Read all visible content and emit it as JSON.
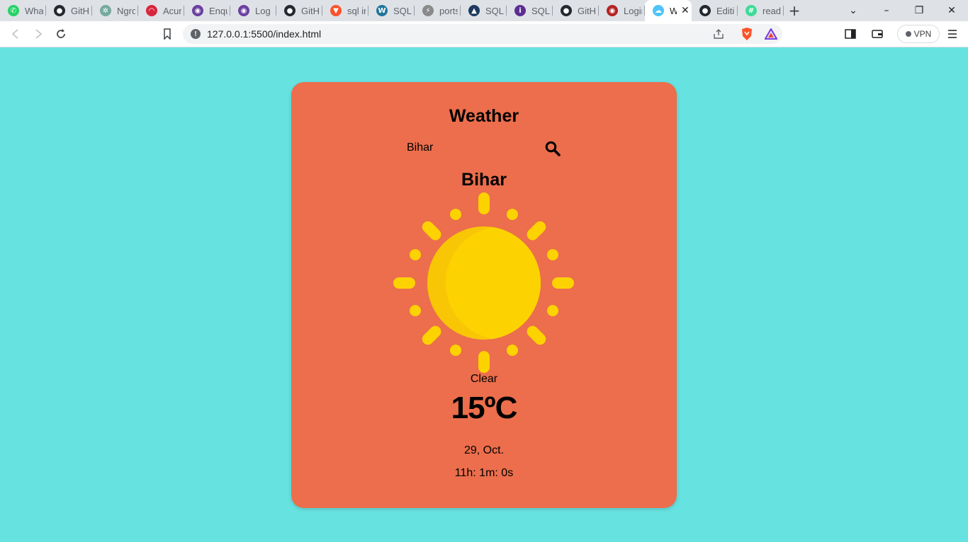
{
  "browser": {
    "tabs": [
      {
        "title": "What",
        "icon": "whatsapp-icon",
        "color": "#25d366"
      },
      {
        "title": "GitHu",
        "icon": "github-icon",
        "color": "#24292f"
      },
      {
        "title": "Ngro",
        "icon": "chatgpt-icon",
        "color": "#74aa9c"
      },
      {
        "title": "Acun",
        "icon": "acunetix-icon",
        "color": "#d7263d"
      },
      {
        "title": "Enqu",
        "icon": "site-icon",
        "color": "#6b3fa0"
      },
      {
        "title": "Log I",
        "icon": "site-icon",
        "color": "#6b3fa0"
      },
      {
        "title": "GitHu",
        "icon": "github-icon",
        "color": "#24292f"
      },
      {
        "title": "sql in",
        "icon": "brave-icon",
        "color": "#fb542b"
      },
      {
        "title": "SQL",
        "icon": "wordpress-icon",
        "color": "#21759b"
      },
      {
        "title": "ports",
        "icon": "bolt-icon",
        "color": "#8a8a8a"
      },
      {
        "title": "SQL",
        "icon": "shield-icon",
        "color": "#1e3a5f"
      },
      {
        "title": "SQL",
        "icon": "info-icon",
        "color": "#5c2d91"
      },
      {
        "title": "GitHu",
        "icon": "github-icon",
        "color": "#24292f"
      },
      {
        "title": "Login",
        "icon": "site-icon",
        "color": "#b22222"
      },
      {
        "title": "W",
        "icon": "cloud-icon",
        "color": "#4fc3f7",
        "active": true
      },
      {
        "title": "Editir",
        "icon": "github-icon",
        "color": "#24292f"
      },
      {
        "title": "readr",
        "icon": "hash-icon",
        "color": "#3ddc97"
      }
    ],
    "new_tab": "+",
    "url": "127.0.0.1:5500/index.html",
    "vpn_label": "VPN"
  },
  "app": {
    "title": "Weather",
    "search": {
      "value": "Bihar",
      "placeholder": ""
    },
    "city": "Bihar",
    "condition": "Clear",
    "temperature": "15ºC",
    "date": "29, Oct.",
    "time": "11h: 1m: 0s",
    "colors": {
      "background": "#66e3e1",
      "card": "#ec6e4c",
      "sun": "#fdd201",
      "sun_shadow": "#f9c606"
    }
  }
}
